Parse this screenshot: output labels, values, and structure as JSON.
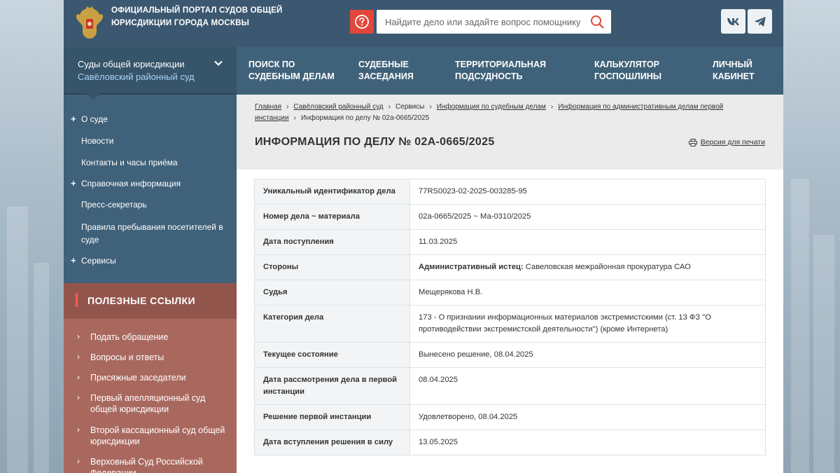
{
  "header": {
    "portal_title": "Официальный портал судов общей юрисдикции города Москвы",
    "search_placeholder": "Найдите дело или задайте вопрос помощнику",
    "social": {
      "vk": "vk",
      "tg": "telegram"
    }
  },
  "nav": {
    "court_select_title": "Суды общей юрисдикции",
    "court_select_sub": "Савёловский районный суд",
    "items": [
      {
        "label": "Поиск по судебным делам"
      },
      {
        "label": "Судебные заседания"
      },
      {
        "label": "Территориальная подсудность"
      },
      {
        "label": "Калькулятор госпошлины"
      },
      {
        "label": "Личный кабинет"
      }
    ]
  },
  "sidebar": {
    "items": [
      {
        "label": "О суде",
        "expandable": true
      },
      {
        "label": "Новости",
        "expandable": false
      },
      {
        "label": "Контакты и часы приёма",
        "expandable": false
      },
      {
        "label": "Справочная информация",
        "expandable": true
      },
      {
        "label": "Пресс-секретарь",
        "expandable": false
      },
      {
        "label": "Правила пребывания посетителей в суде",
        "expandable": false
      },
      {
        "label": "Сервисы",
        "expandable": true
      }
    ]
  },
  "useful": {
    "title": "Полезные ссылки",
    "links": [
      {
        "label": "Подать обращение"
      },
      {
        "label": "Вопросы и ответы"
      },
      {
        "label": "Присяжные заседатели"
      },
      {
        "label": "Первый апелляционный суд общей юрисдикции"
      },
      {
        "label": "Второй кассационный суд общей юрисдикции"
      },
      {
        "label": "Верховный Суд Российской Федерации"
      }
    ]
  },
  "breadcrumb": [
    {
      "label": "Главная",
      "link": true
    },
    {
      "label": "Савёловский районный суд",
      "link": true
    },
    {
      "label": "Сервисы",
      "link": false
    },
    {
      "label": "Информация по судебным делам",
      "link": true
    },
    {
      "label": "Информация по административным делам первой инстанции",
      "link": true
    },
    {
      "label": "Информация по делу № 02а-0665/2025",
      "link": false
    }
  ],
  "page_title": "Информация по делу № 02А-0665/2025",
  "print_label": "Версия для печати",
  "case_info": {
    "rows": [
      {
        "key": "Уникальный идентификатор дела",
        "value": "77RS0023-02-2025-003285-95"
      },
      {
        "key": "Номер дела ~ материала",
        "value": "02а-0665/2025 ~ Ма-0310/2025"
      },
      {
        "key": "Дата поступления",
        "value": "11.03.2025"
      },
      {
        "key": "Стороны",
        "party_role": "Административный истец:",
        "party_name": " Савеловская межрайонная прокуратура САО"
      },
      {
        "key": "Судья",
        "value": "Мещерякова Н.В."
      },
      {
        "key": "Категория дела",
        "value": "173 - О признании информационных материалов экстремистскими (ст. 13 ФЗ \"О противодействии экстремистской деятельности\") (кроме Интернета)"
      },
      {
        "key": "Текущее состояние",
        "value": "Вынесено решение, 08.04.2025"
      },
      {
        "key": "Дата рассмотрения дела в первой инстанции",
        "value": "08.04.2025"
      },
      {
        "key": "Решение первой инстанции",
        "value": "Удовлетворено, 08.04.2025"
      },
      {
        "key": "Дата вступления решения в силу",
        "value": "13.05.2025"
      }
    ]
  },
  "colors": {
    "header_bg": "#3b5870",
    "nav_bg": "#3f6179",
    "help_red": "#e2473b",
    "useful_bg": "#a9685e",
    "court_sub": "#a9d4f5"
  }
}
